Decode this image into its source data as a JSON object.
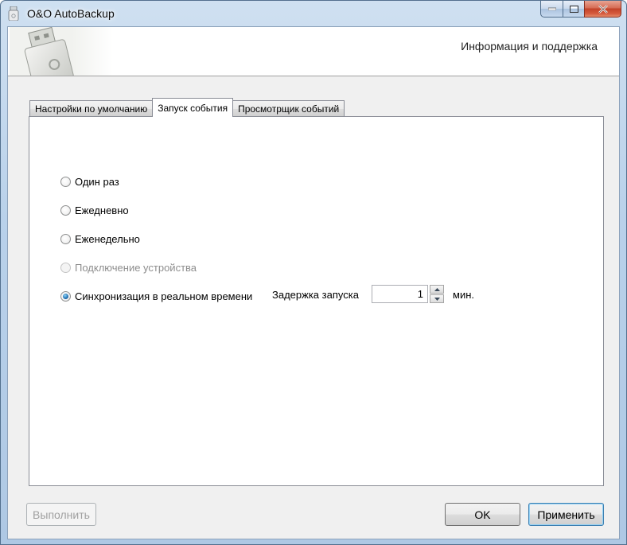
{
  "window": {
    "title": "O&O AutoBackup"
  },
  "header": {
    "title": "Информация и поддержка"
  },
  "tabs": [
    {
      "label": "Настройки по умолчанию",
      "active": false
    },
    {
      "label": "Запуск события",
      "active": true
    },
    {
      "label": "Просмотрщик событий",
      "active": false
    }
  ],
  "options": [
    {
      "label": "Один раз",
      "checked": false,
      "enabled": true
    },
    {
      "label": "Ежедневно",
      "checked": false,
      "enabled": true
    },
    {
      "label": "Еженедельно",
      "checked": false,
      "enabled": true
    },
    {
      "label": "Подключение устройства",
      "checked": false,
      "enabled": false
    },
    {
      "label": "Синхронизация в реальном времени",
      "checked": true,
      "enabled": true
    }
  ],
  "delay": {
    "label": "Задержка запуска",
    "value": "1",
    "unit": "мин."
  },
  "buttons": {
    "execute": "Выполнить",
    "ok": "OK",
    "apply": "Применить"
  },
  "colors": {
    "accent": "#3c7fb1",
    "titlebar": "#b9d1ea",
    "close": "#c2432a"
  },
  "icons": [
    "app-icon",
    "usb-drive-icon",
    "minimize-icon",
    "maximize-icon",
    "close-icon",
    "spin-up-icon",
    "spin-down-icon"
  ]
}
